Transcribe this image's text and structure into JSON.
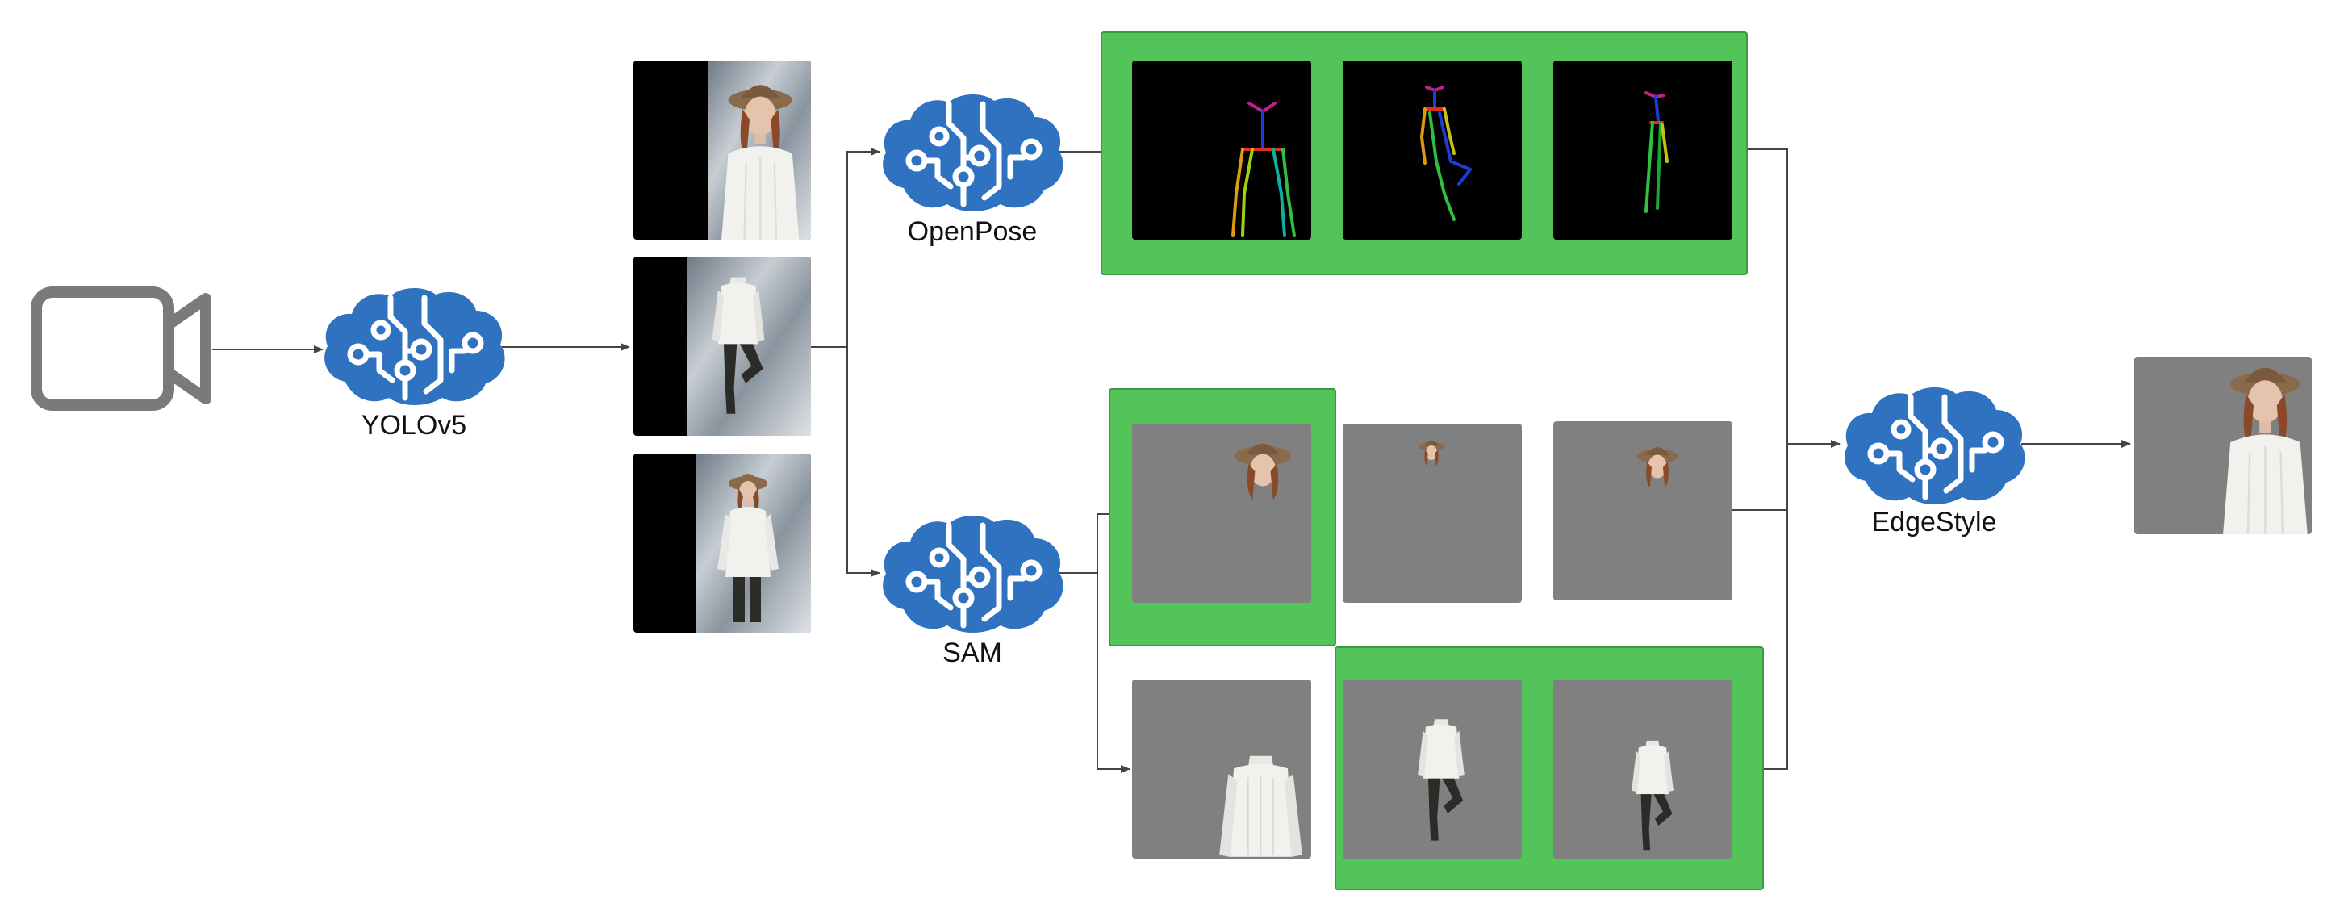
{
  "nodes": {
    "camera": {
      "icon": "video-camera-icon"
    },
    "yolo": {
      "label": "YOLOv5",
      "icon": "ai-brain-circuit-icon"
    },
    "openpose": {
      "label": "OpenPose",
      "icon": "ai-brain-circuit-icon"
    },
    "sam": {
      "label": "SAM",
      "icon": "ai-brain-circuit-icon"
    },
    "edgestyle": {
      "label": "EdgeStyle",
      "icon": "ai-brain-circuit-icon"
    }
  },
  "colors": {
    "brain": "#2f72bf",
    "highlight": "#52c45a",
    "panel_gray": "#808080",
    "pose_bg": "#000000",
    "arrow": "#444444",
    "camera": "#7a7a7a"
  },
  "crops": [
    {
      "content": "person-portrait-crop"
    },
    {
      "content": "person-full-body-crop"
    },
    {
      "content": "person-standing-crop"
    }
  ],
  "pose_panels": [
    {
      "content": "openpose-skeleton-front"
    },
    {
      "content": "openpose-skeleton-side-pose"
    },
    {
      "content": "openpose-skeleton-side"
    }
  ],
  "segment_panels": {
    "heads": [
      "head-segment-large",
      "head-segment-small",
      "head-segment-medium"
    ],
    "bodies": [
      "clothing-segment-sweater",
      "clothing-segment-full",
      "clothing-segment-side"
    ]
  },
  "output": {
    "content": "generated-person-output"
  }
}
